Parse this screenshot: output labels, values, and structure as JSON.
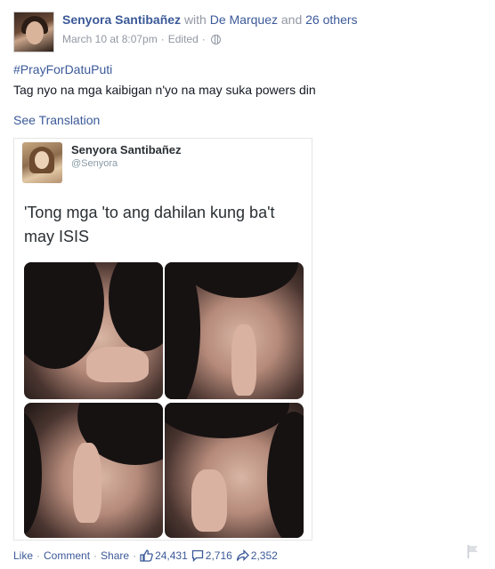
{
  "post": {
    "author": "Senyora Santibañez",
    "with_text": "with",
    "tagged_name": "De Marquez",
    "and_text": "and",
    "others_text": "26 others",
    "timestamp": "March 10 at 8:07pm",
    "edited": "Edited",
    "hashtag": "#PrayForDatuPuti",
    "text": "Tag nyo na mga kaibigan n'yo na may suka powers din",
    "see_translation": "See Translation"
  },
  "shared_tweet": {
    "name": "Senyora Santibañez",
    "handle": "@Senyora",
    "text": "'Tong mga 'to ang dahilan kung ba't may ISIS"
  },
  "footer": {
    "like": "Like",
    "comment": "Comment",
    "share": "Share",
    "likes_count": "24,431",
    "comments_count": "2,716",
    "shares_count": "2,352"
  },
  "icons": {
    "privacy": "globe-icon",
    "likes": "thumbs-up-icon",
    "comments": "comment-bubble-icon",
    "shares": "share-arrow-icon",
    "report": "flag-icon"
  },
  "colors": {
    "link": "#3b5998",
    "muted": "#9197a3",
    "text": "#141823"
  }
}
